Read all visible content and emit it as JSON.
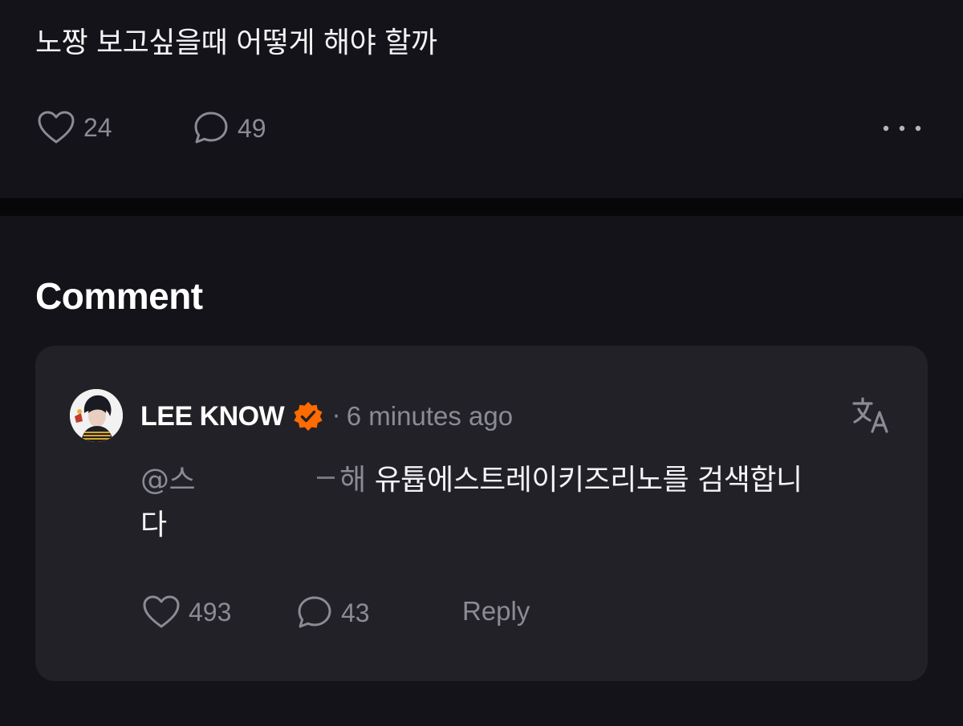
{
  "post": {
    "text": "노짱 보고싶을때 어떻게 해야 할까",
    "likes": "24",
    "comments": "49"
  },
  "comment_section": {
    "heading": "Comment",
    "comment": {
      "author": "LEE KNOW",
      "separator": "·",
      "time": "6 minutes ago",
      "mention": "@스",
      "mention_tail": "해",
      "text_line1": "유튭에스트레이키즈리노를 검색합니",
      "text_line2": "다",
      "likes": "493",
      "replies": "43",
      "reply_label": "Reply"
    }
  },
  "colors": {
    "background": "#131319",
    "card": "#212127",
    "muted": "#8b8b93",
    "verified_badge": "#ff6b00"
  },
  "icons": [
    "heart-icon",
    "speech-bubble-icon",
    "more-dots-icon",
    "verified-badge-icon",
    "translate-icon"
  ]
}
